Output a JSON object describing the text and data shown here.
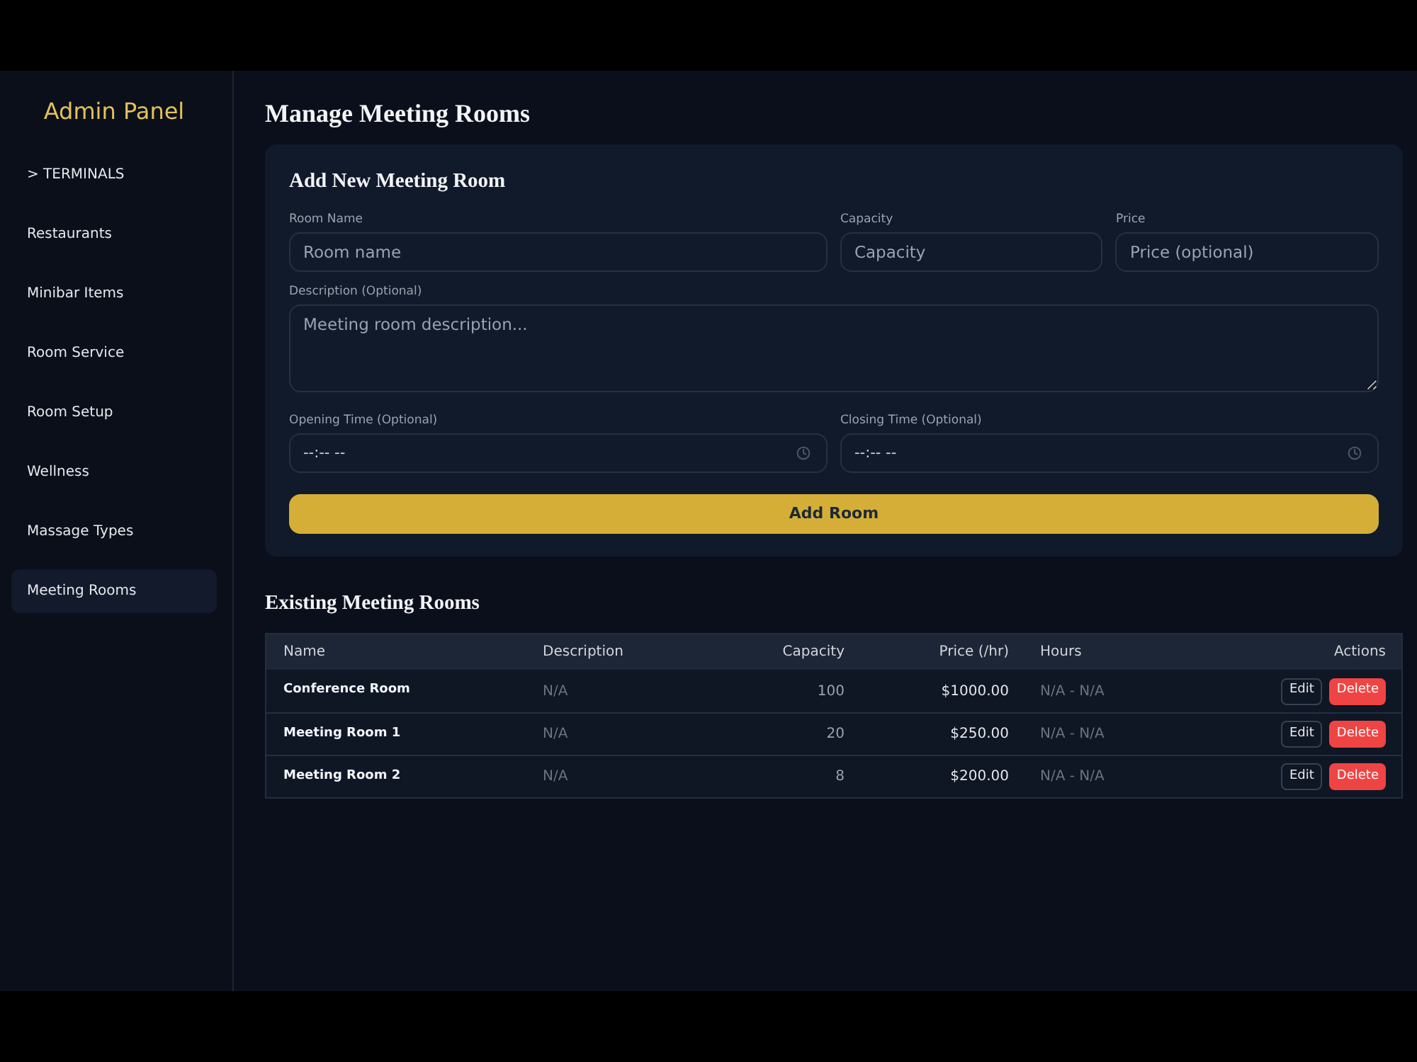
{
  "sidebar": {
    "title": "Admin Panel",
    "items": [
      {
        "label": "> TERMINALS",
        "selected": false
      },
      {
        "label": "Restaurants",
        "selected": false
      },
      {
        "label": "Minibar Items",
        "selected": false
      },
      {
        "label": "Room Service",
        "selected": false
      },
      {
        "label": "Room Setup",
        "selected": false
      },
      {
        "label": "Wellness",
        "selected": false
      },
      {
        "label": "Massage Types",
        "selected": false
      },
      {
        "label": "Meeting Rooms",
        "selected": true
      }
    ]
  },
  "page_title": "Manage Meeting Rooms",
  "form": {
    "title": "Add New Meeting Room",
    "fields": [
      {
        "label": "Room Name",
        "placeholder": "Room name"
      },
      {
        "label": "Capacity",
        "placeholder": "Capacity"
      },
      {
        "label": "Price",
        "placeholder": "Price (optional)"
      }
    ],
    "description": {
      "label": "Description (Optional)",
      "placeholder": "Meeting room description..."
    },
    "times": [
      {
        "label": "Opening Time (Optional)",
        "placeholder": "--:-- --"
      },
      {
        "label": "Closing Time (Optional)",
        "placeholder": "--:-- --"
      }
    ],
    "submit": "Add Room"
  },
  "table": {
    "title": "Existing Meeting Rooms",
    "columns": [
      "Name",
      "Description",
      "Capacity",
      "Price (/hr)",
      "Hours",
      "Actions"
    ],
    "rows": [
      {
        "cells": [
          "Conference Room",
          "N/A",
          "100",
          "$1000.00",
          "N/A - N/A"
        ],
        "actions": [
          {
            "label": "Edit",
            "kind": "secondary"
          },
          {
            "label": "Delete",
            "kind": "danger"
          }
        ]
      },
      {
        "cells": [
          "Meeting Room 1",
          "N/A",
          "20",
          "$250.00",
          "N/A - N/A"
        ],
        "actions": [
          {
            "label": "Edit",
            "kind": "secondary"
          },
          {
            "label": "Delete",
            "kind": "danger"
          }
        ]
      },
      {
        "cells": [
          "Meeting Room 2",
          "N/A",
          "8",
          "$200.00",
          "N/A - N/A"
        ],
        "actions": [
          {
            "label": "Edit",
            "kind": "secondary"
          },
          {
            "label": "Delete",
            "kind": "danger"
          }
        ]
      }
    ]
  }
}
